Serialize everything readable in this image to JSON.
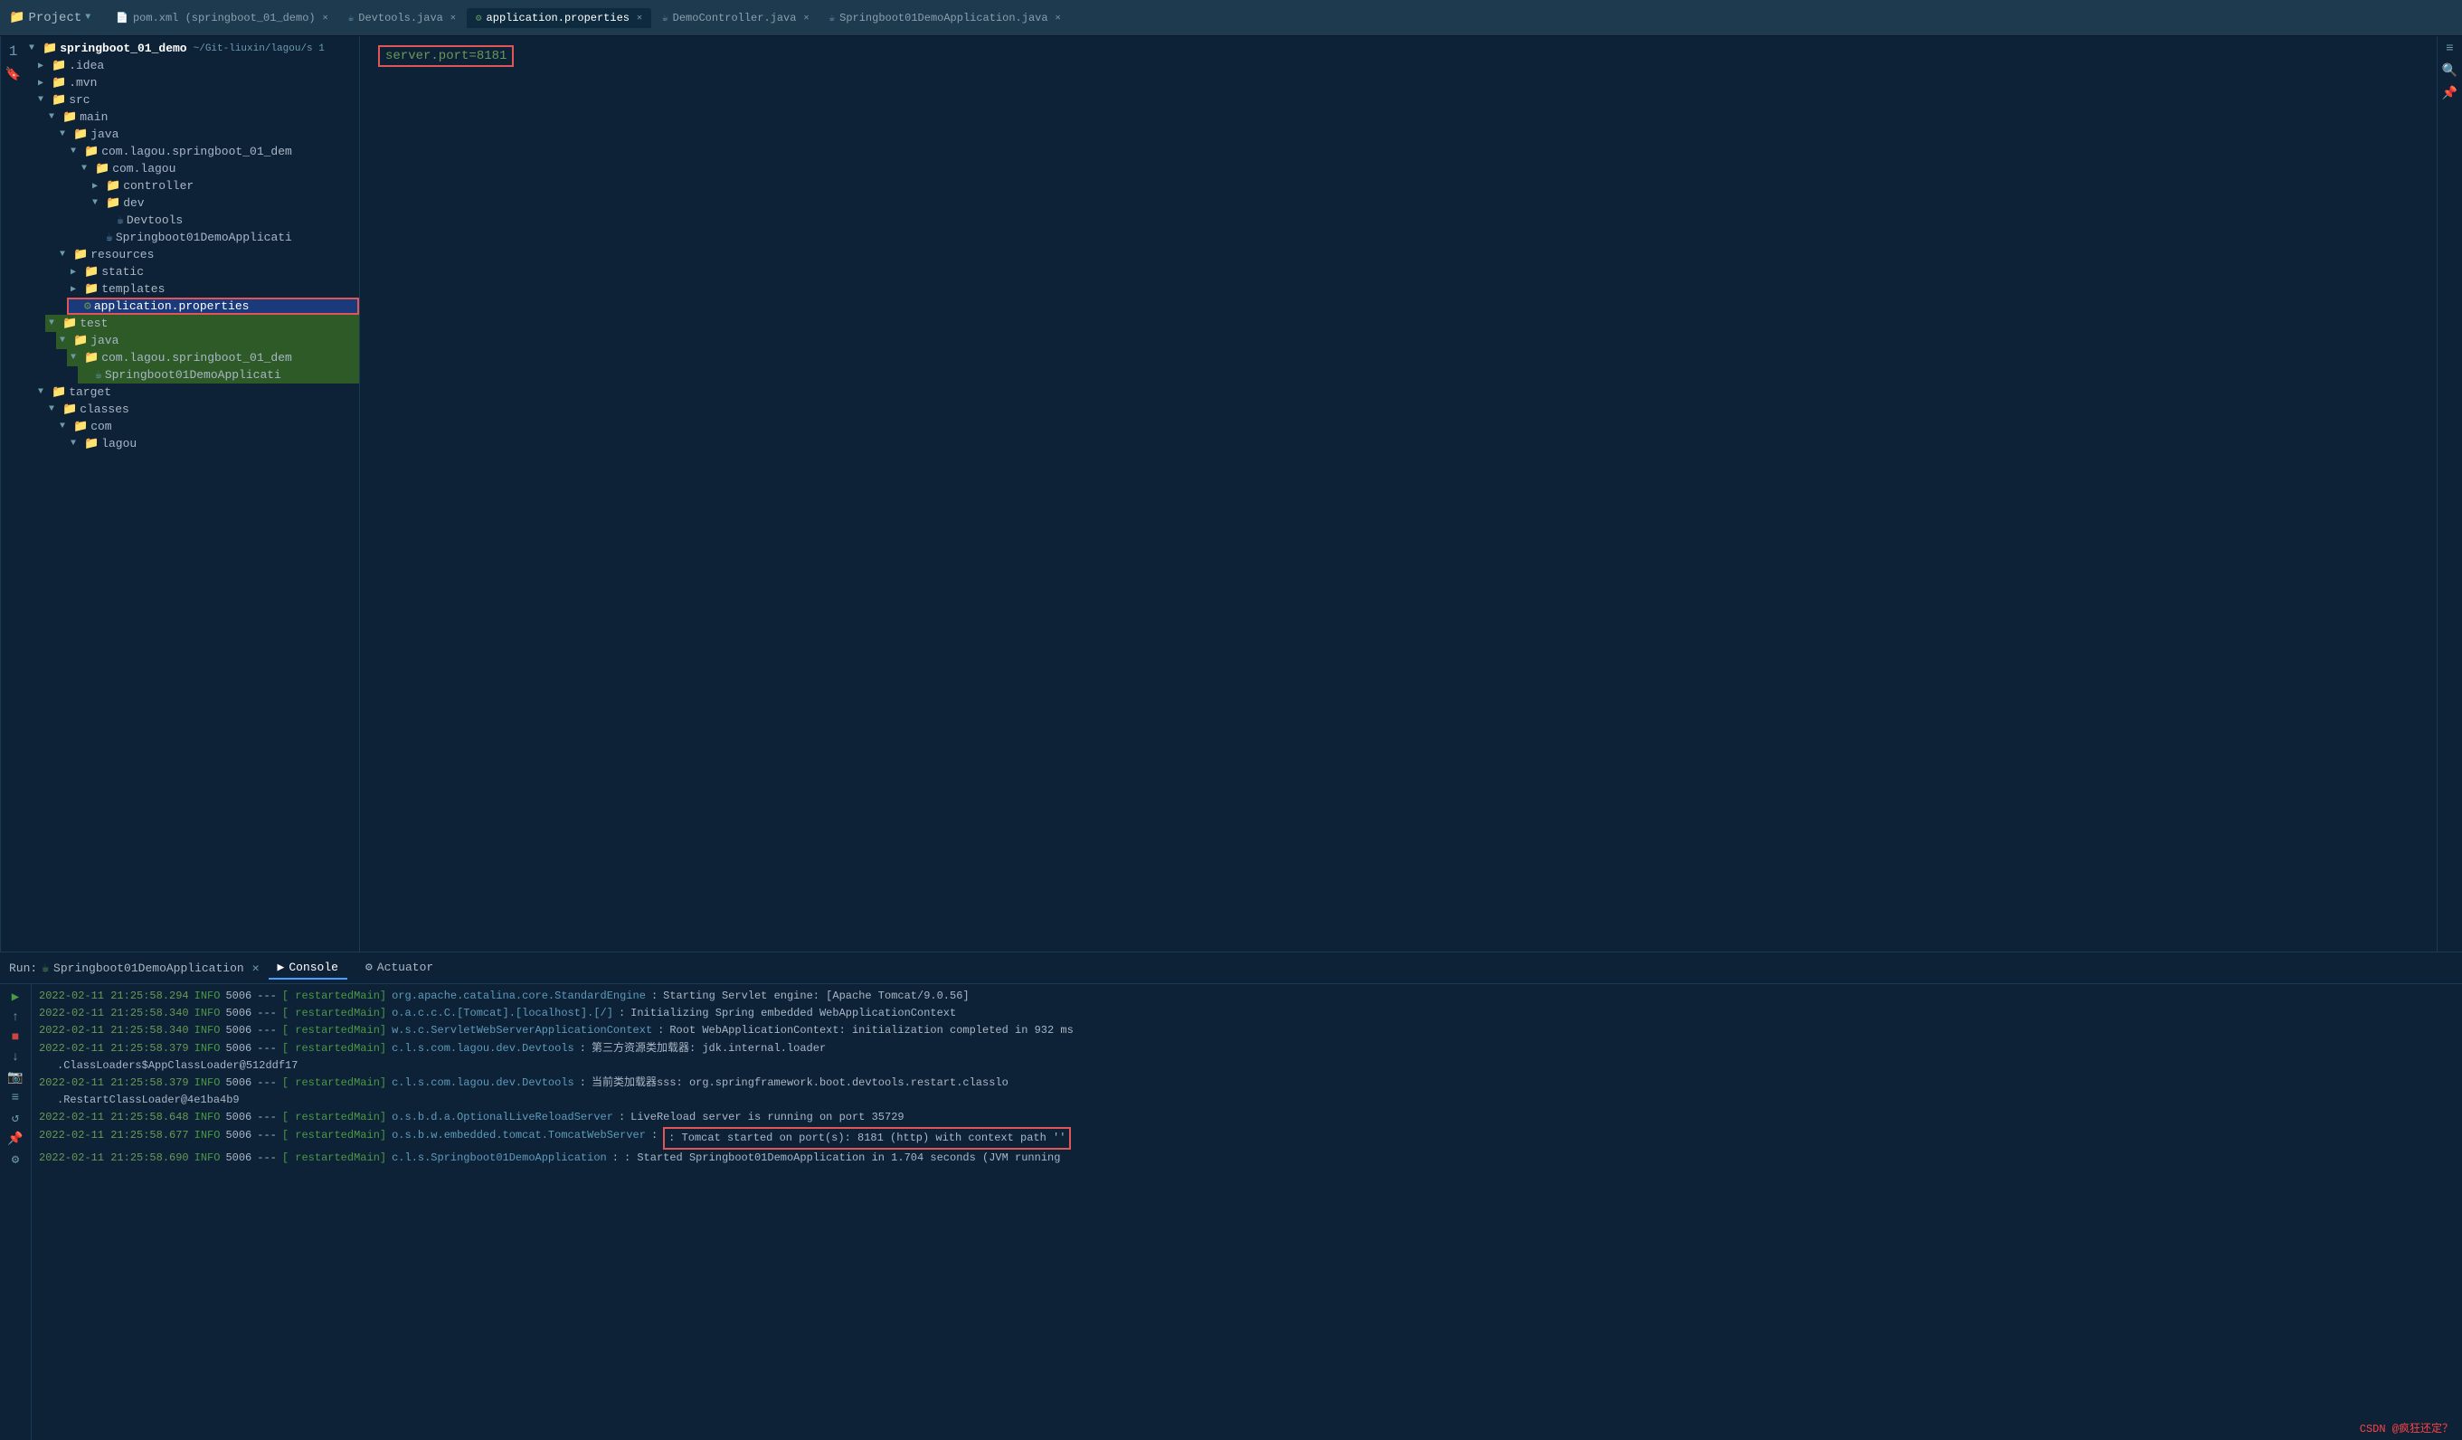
{
  "titleBar": {
    "projectLabel": "Project",
    "dropdownArrow": "▼",
    "icons": [
      "⚙",
      "≡",
      "⇌",
      "⚙",
      "—"
    ],
    "tabs": [
      {
        "id": "pom",
        "label": "pom.xml (springboot_01_demo)",
        "icon": "xml",
        "active": false
      },
      {
        "id": "devtools",
        "label": "Devtools.java",
        "icon": "java",
        "active": false
      },
      {
        "id": "appprops",
        "label": "application.properties",
        "icon": "prop",
        "active": true
      },
      {
        "id": "democontroller",
        "label": "DemoController.java",
        "icon": "java",
        "active": false
      },
      {
        "id": "springbootapp",
        "label": "Springboot01DemoApplication.java",
        "icon": "java",
        "active": false
      }
    ]
  },
  "sidebar": {
    "rootLabel": "springboot_01_demo",
    "rootSuffix": "~/Git-liuxin/lagou/s 1",
    "items": [
      {
        "indent": 1,
        "type": "folder",
        "label": ".idea",
        "arrow": "▶"
      },
      {
        "indent": 1,
        "type": "folder",
        "label": ".mvn",
        "arrow": "▶"
      },
      {
        "indent": 1,
        "type": "folder",
        "label": "src",
        "arrow": "▼",
        "open": true
      },
      {
        "indent": 2,
        "type": "folder",
        "label": "main",
        "arrow": "▼",
        "open": true
      },
      {
        "indent": 3,
        "type": "folder",
        "label": "java",
        "arrow": "▼",
        "open": true,
        "color": "blue"
      },
      {
        "indent": 4,
        "type": "folder",
        "label": "com.lagou.springboot_01_dem",
        "arrow": "▼",
        "open": true
      },
      {
        "indent": 5,
        "type": "folder",
        "label": "com.lagou",
        "arrow": "▼",
        "open": true
      },
      {
        "indent": 6,
        "type": "folder",
        "label": "controller",
        "arrow": "▶"
      },
      {
        "indent": 6,
        "type": "folder",
        "label": "dev",
        "arrow": "▼",
        "open": true
      },
      {
        "indent": 7,
        "type": "file-java",
        "label": "Devtools"
      },
      {
        "indent": 6,
        "type": "file-java",
        "label": "Springboot01DemoApplicati"
      },
      {
        "indent": 3,
        "type": "folder",
        "label": "resources",
        "arrow": "▼",
        "open": true
      },
      {
        "indent": 4,
        "type": "folder",
        "label": "static",
        "arrow": "▶"
      },
      {
        "indent": 4,
        "type": "folder",
        "label": "templates",
        "arrow": "▶"
      },
      {
        "indent": 4,
        "type": "file-prop",
        "label": "application.properties",
        "selected": true,
        "highlighted": true
      },
      {
        "indent": 2,
        "type": "folder",
        "label": "test",
        "arrow": "▼",
        "open": true
      },
      {
        "indent": 3,
        "type": "folder",
        "label": "java",
        "arrow": "▼",
        "open": true,
        "color": "blue"
      },
      {
        "indent": 4,
        "type": "folder",
        "label": "com.lagou.springboot_01_dem",
        "arrow": "▼",
        "open": true
      },
      {
        "indent": 5,
        "type": "file-java",
        "label": "Springboot01DemoApplicati"
      },
      {
        "indent": 1,
        "type": "folder",
        "label": "target",
        "arrow": "▼",
        "open": true
      },
      {
        "indent": 2,
        "type": "folder",
        "label": "classes",
        "arrow": "▼",
        "open": true
      },
      {
        "indent": 3,
        "type": "folder",
        "label": "com",
        "arrow": "▼",
        "open": true
      },
      {
        "indent": 4,
        "type": "folder",
        "label": "lagou",
        "arrow": "▼",
        "open": true
      }
    ]
  },
  "editor": {
    "content": "server.port=8181"
  },
  "runPanel": {
    "label": "Run:",
    "appName": "Springboot01DemoApplication",
    "closeBtn": "✕",
    "tabs": [
      {
        "id": "console",
        "label": "Console",
        "icon": "▶",
        "active": true
      },
      {
        "id": "actuator",
        "label": "Actuator",
        "icon": "⚙",
        "active": false
      }
    ],
    "logs": [
      {
        "timestamp": "2022-02-11 21:25:58.294",
        "level": "INFO",
        "pid": "5006",
        "dashes": "---",
        "thread": "restartedMain",
        "class": "org.apache.catalina.core.StandardEngine",
        "message": ": Starting Servlet engine: [Apache Tomcat/9.0.56]"
      },
      {
        "timestamp": "2022-02-11 21:25:58.340",
        "level": "INFO",
        "pid": "5006",
        "dashes": "---",
        "thread": "restartedMain",
        "class": "o.a.c.c.C.[Tomcat].[localhost].[/]",
        "message": ": Initializing Spring embedded WebApplicationContext"
      },
      {
        "timestamp": "2022-02-11 21:25:58.340",
        "level": "INFO",
        "pid": "5006",
        "dashes": "---",
        "thread": "restartedMain",
        "class": "w.s.c.ServletWebServerApplicationContext",
        "message": ": Root WebApplicationContext: initialization completed in 932 ms"
      },
      {
        "timestamp": "2022-02-11 21:25:58.379",
        "level": "INFO",
        "pid": "5006",
        "dashes": "---",
        "thread": "restartedMain",
        "class": "c.l.s.com.lagou.dev.Devtools",
        "message": ": 第三方资源类加载器: jdk.internal.loader"
      },
      {
        "timestamp": "",
        "level": "",
        "pid": "",
        "dashes": "",
        "thread": "",
        "class": "",
        "message": ".ClassLoaders$AppClassLoader@512ddf17",
        "wrap": true
      },
      {
        "timestamp": "2022-02-11 21:25:58.379",
        "level": "INFO",
        "pid": "5006",
        "dashes": "---",
        "thread": "restartedMain",
        "class": "c.l.s.com.lagou.dev.Devtools",
        "message": ": 当前类加载器sss: org.springframework.boot.devtools.restart.classlo"
      },
      {
        "timestamp": "",
        "level": "",
        "pid": "",
        "dashes": "",
        "thread": "",
        "class": "",
        "message": ".RestartClassLoader@4e1ba4b9",
        "wrap": true
      },
      {
        "timestamp": "2022-02-11 21:25:58.648",
        "level": "INFO",
        "pid": "5006",
        "dashes": "---",
        "thread": "restartedMain",
        "class": "o.s.b.d.a.OptionalLiveReloadServer",
        "message": ": LiveReload server is running on port 35729"
      },
      {
        "timestamp": "2022-02-11 21:25:58.677",
        "level": "INFO",
        "pid": "5006",
        "dashes": "---",
        "thread": "restartedMain",
        "class": "o.s.b.w.embedded.tomcat.TomcatWebServer",
        "message": ": Tomcat started on port(s): 8181 (http) with context path ''",
        "highlighted": true
      },
      {
        "timestamp": "2022-02-11 21:25:58.690",
        "level": "INFO",
        "pid": "5006",
        "dashes": "---",
        "thread": "restartedMain",
        "class": "c.l.s.Springboot01DemoApplication",
        "message": ": Started Springboot01DemoApplication in 1.704 seconds (JVM running"
      }
    ]
  },
  "watermark": {
    "text": "CSDN @疯狂还定？"
  }
}
